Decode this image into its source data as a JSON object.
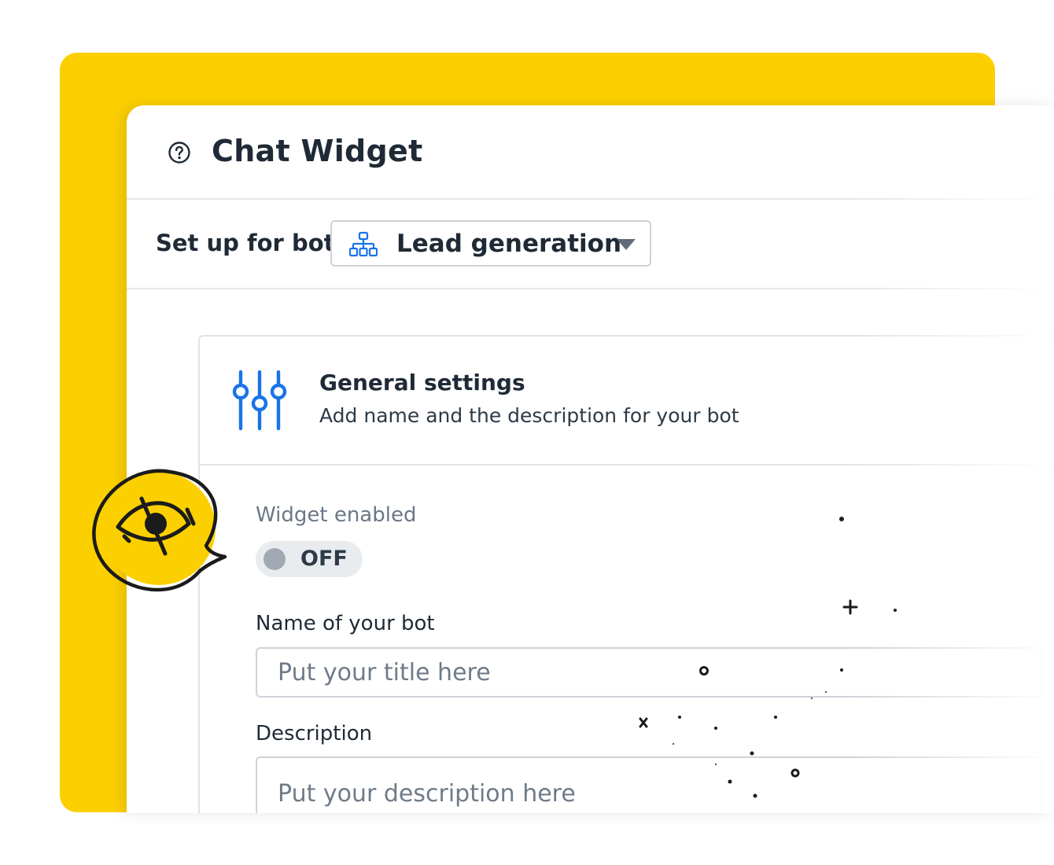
{
  "header": {
    "title": "Chat Widget"
  },
  "bot_setup": {
    "label": "Set up for bot",
    "selected_bot": "Lead generation"
  },
  "general_settings": {
    "title": "General settings",
    "subtitle": "Add name and the description for your bot"
  },
  "widget_toggle": {
    "label": "Widget enabled",
    "state": "OFF"
  },
  "bot_name": {
    "label": "Name of your bot",
    "placeholder": "Put your title here",
    "value": ""
  },
  "description": {
    "label": "Description",
    "placeholder": "Put your description here",
    "value": ""
  },
  "colors": {
    "accent_yellow": "#fcd000",
    "icon_blue": "#1a73e8",
    "text_dark": "#1f2a36"
  },
  "icons": {
    "help": "question-circle-icon",
    "bot_select": "org-chart-icon",
    "settings": "sliders-icon",
    "visibility": "eye-slash-icon"
  }
}
